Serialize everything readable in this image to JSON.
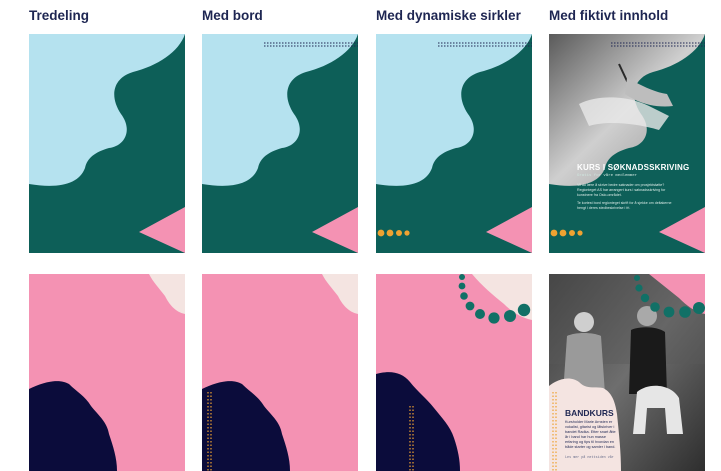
{
  "columns": [
    {
      "title": "Tredeling"
    },
    {
      "title": "Med bord"
    },
    {
      "title": "Med dynamiske sirkler"
    },
    {
      "title": "Med fiktivt innhold"
    }
  ],
  "sample_course": {
    "title": "KURS I SØKNADSSKRIVING",
    "subtitle": "Gratis for våre medlemmer",
    "paragraph_1": "Vil du lære å skrive bedre søknader om prosjektstøtte? Regionteget AS har arrangert kurs i søknadsskriving for kunstnere fra Oslo-området.",
    "paragraph_2": "Te kortest bord regionteget skrift for å sjekke om deltakerne hengt i deres stedbeskrivelse i fri."
  },
  "sample_band": {
    "title": "BANDKURS",
    "body": "Kursholder Marie Arnsten er vokalist, gitarist og låtskriver i bandet Radka. Etter snart åtte år i band har hun masse erfaring og tips til hvordan en både starter og samler i band.",
    "footer": "Les mer på nettsiden vår"
  },
  "colors": {
    "green": "#0d5f58",
    "light_blue": "#b5e2ef",
    "pink": "#f492b3",
    "cream": "#f4e4e1",
    "navy": "#0b0c3b",
    "orange": "#efa231",
    "teal_dot": "#117066",
    "title_navy": "#1e2652"
  }
}
